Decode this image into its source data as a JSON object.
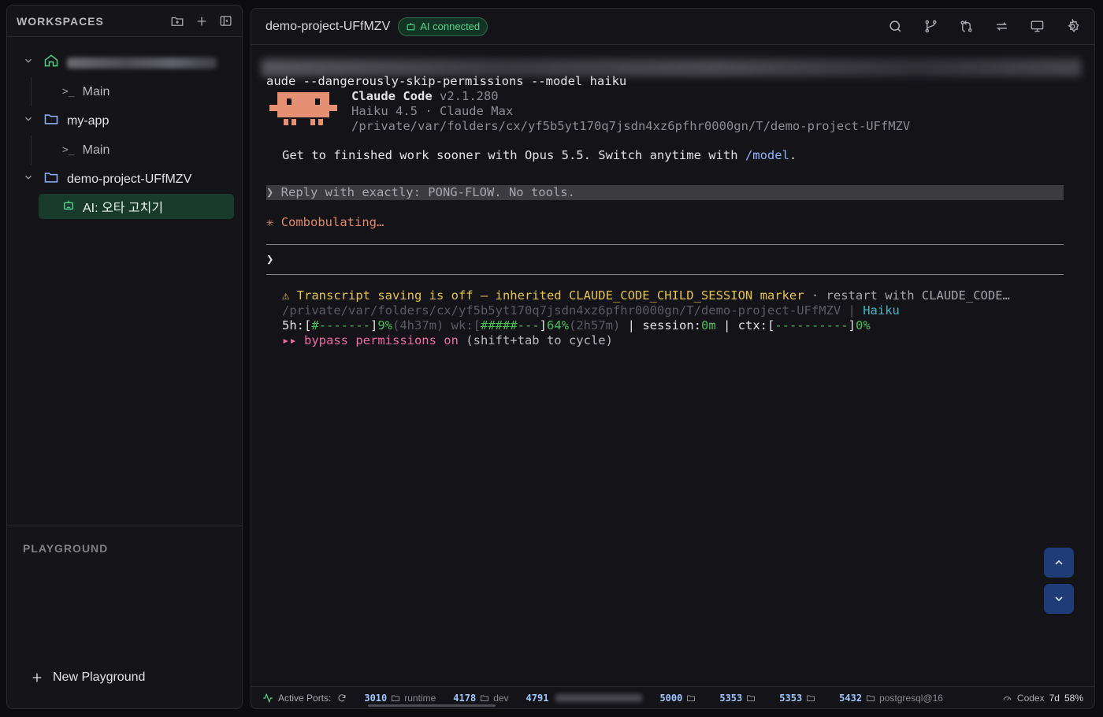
{
  "sidebar": {
    "title": "WORKSPACES",
    "workspaces": [
      {
        "name": "",
        "sub": "Main"
      },
      {
        "name": "my-app",
        "sub": "Main"
      },
      {
        "name": "demo-project-UFfMZV",
        "sub": "AI: 오타 고치기"
      }
    ],
    "playground_title": "PLAYGROUND",
    "new_playground": "New Playground"
  },
  "header": {
    "project": "demo-project-UFfMZV",
    "ai_badge": "AI connected"
  },
  "terminal": {
    "line_cmd": "aude --dangerously-skip-permissions --model haiku",
    "app_name": "Claude Code",
    "app_version": " v2.1.280",
    "model_line": "Haiku 4.5 · Claude Max",
    "path_line": "/private/var/folders/cx/yf5b5yt170q7jsdn4xz6pfhr0000gn/T/demo-project-UFfMZV",
    "tip_pre": "Get to finished work sooner with Opus 5.5. Switch anytime with ",
    "tip_cmd": "/model",
    "tip_post": ".",
    "reply_prompt": "❯ Reply with exactly: PONG-FLOW. No tools.",
    "spinner_char": "✳",
    "spinner_text": "Combobulating…",
    "input_prompt": "❯",
    "warn_text": "⚠ Transcript saving is off — inherited CLAUDE_CODE_CHILD_SESSION marker",
    "warn_tail": " · restart with CLAUDE_CODE…",
    "status_path": "/private/var/folders/cx/yf5b5yt170q7jsdn4xz6pfhr0000gn/T/demo-project-UFfMZV",
    "status_sep": " | ",
    "status_model": "Haiku",
    "usage_5h_label": "5h:[",
    "usage_5h_bar": "#-------",
    "usage_5h_close": "]",
    "usage_5h_pct": "9%",
    "usage_5h_time": "(4h37m)",
    "usage_wk_label": " wk:[",
    "usage_wk_bar": "#####---",
    "usage_wk_close": "]",
    "usage_wk_pct": "64%",
    "usage_wk_time": "(2h57m)",
    "usage_session_label": " | session:",
    "usage_session_val": "0m",
    "usage_ctx_label": " | ctx:[",
    "usage_ctx_bar": "----------",
    "usage_ctx_close": "]",
    "usage_ctx_pct": "0%",
    "bypass_arrows": "▸▸ ",
    "bypass_text": "bypass permissions on",
    "bypass_hint": " (shift+tab to cycle)"
  },
  "statusbar": {
    "active_ports_label": "Active Ports:",
    "ports": [
      {
        "num": "3010",
        "label": "runtime"
      },
      {
        "num": "4178",
        "label": "dev"
      },
      {
        "num": "4791",
        "label": ""
      },
      {
        "num": "5000",
        "label": ""
      },
      {
        "num": "5353",
        "label": ""
      },
      {
        "num": "5353",
        "label": ""
      },
      {
        "num": "5432",
        "label": "postgresql@16"
      }
    ],
    "codex_label": "Codex",
    "codex_days": "7d",
    "codex_pct": "58%"
  }
}
